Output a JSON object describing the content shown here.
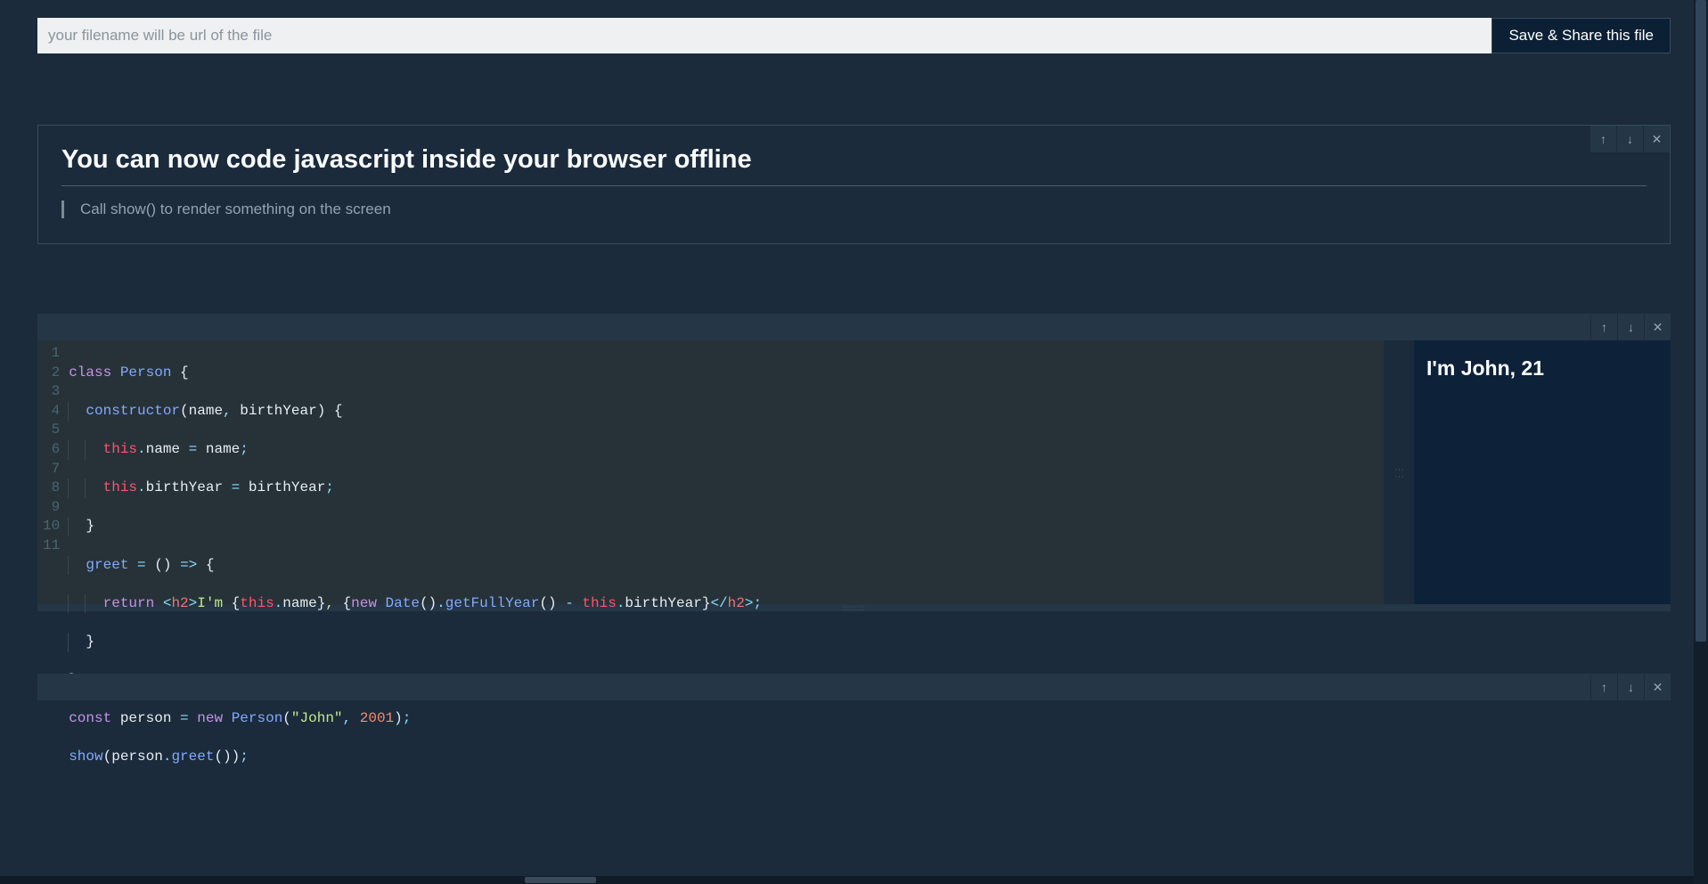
{
  "topbar": {
    "filename_placeholder": "your filename will be url of the file",
    "filename_value": "",
    "save_label": "Save & Share this file"
  },
  "intro": {
    "heading": "You can now code javascript inside your browser offline",
    "quote": "Call show() to render something on the screen"
  },
  "icons": {
    "up": "↑",
    "down": "↓",
    "close": "✕"
  },
  "code": {
    "line_count": 11,
    "lines": [
      "class Person {",
      "  constructor(name, birthYear) {",
      "    this.name = name;",
      "    this.birthYear = birthYear;",
      "  }",
      "  greet = () => {",
      "    return <h2>I'm {this.name}, {new Date().getFullYear() - this.birthYear}</h2>;",
      "  }",
      "}",
      "const person = new Person(\"John\", 2001);",
      "show(person.greet());"
    ]
  },
  "output": {
    "text": "I'm John, 21"
  }
}
